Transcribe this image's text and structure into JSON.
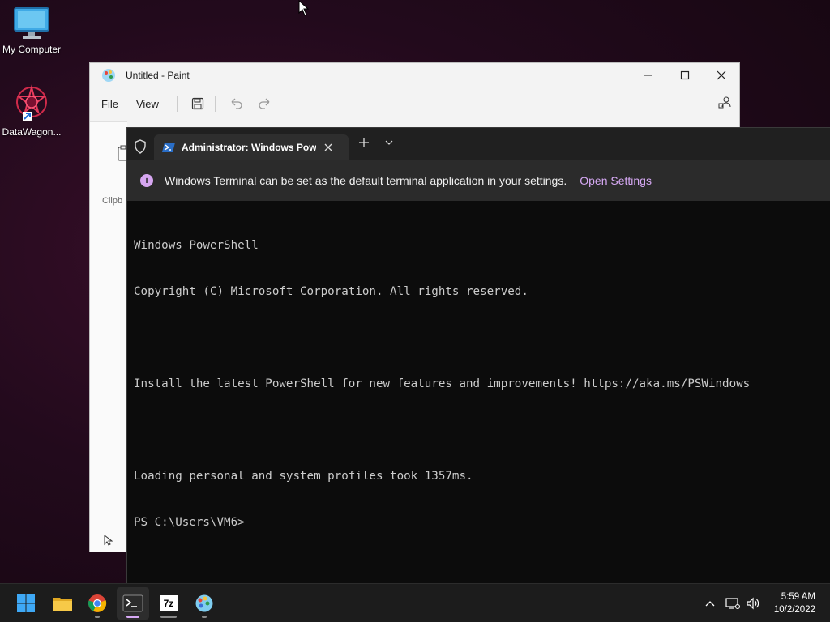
{
  "desktop": {
    "icons": [
      {
        "label": "My Computer",
        "icon": "monitor-icon"
      },
      {
        "label": "DataWagon...",
        "icon": "datawagon-icon"
      }
    ]
  },
  "paint": {
    "title": "Untitled - Paint",
    "menu": {
      "file": "File",
      "view": "View"
    },
    "clipboard_label": "Clipb"
  },
  "terminal": {
    "tab_title": "Administrator: Windows Powe",
    "infobar": {
      "message": "Windows Terminal can be set as the default terminal application in your settings.",
      "action": "Open Settings"
    },
    "lines": [
      "Windows PowerShell",
      "Copyright (C) Microsoft Corporation. All rights reserved.",
      "",
      "Install the latest PowerShell for new features and improvements! https://aka.ms/PSWindows",
      "",
      "Loading personal and system profiles took 1357ms.",
      "PS C:\\Users\\VM6>"
    ]
  },
  "taskbar": {
    "apps": [
      "start-icon",
      "file-explorer-icon",
      "chrome-icon",
      "terminal-icon",
      "7zip-icon",
      "paint-icon"
    ],
    "sevenzip_label": "7z",
    "clock": {
      "time": "5:59 AM",
      "date": "10/2/2022"
    }
  },
  "colors": {
    "accent": "#d7a9f5",
    "terminal_bg": "#0c0c0c",
    "infobar_bg": "#2b2b2b"
  }
}
